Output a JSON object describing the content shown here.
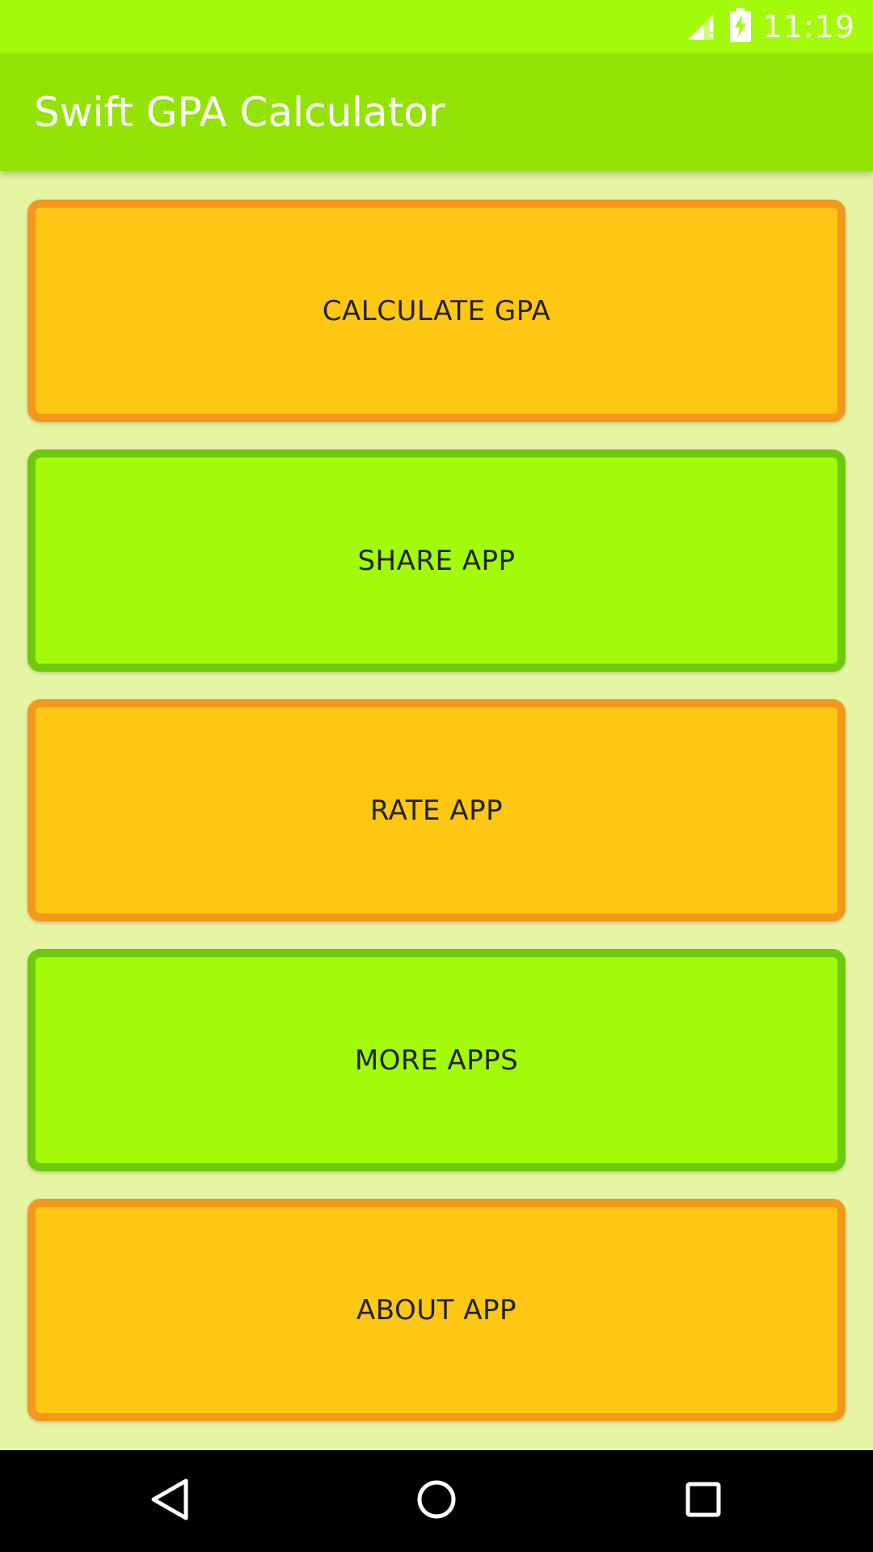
{
  "status_bar": {
    "time": "11:19",
    "icons": [
      "signal-icon",
      "battery-charging-icon"
    ]
  },
  "app_bar": {
    "title": "Swift GPA Calculator"
  },
  "menu": {
    "buttons": [
      {
        "label": "CALCULATE GPA",
        "style": "orange"
      },
      {
        "label": "SHARE APP",
        "style": "green"
      },
      {
        "label": "RATE APP",
        "style": "orange"
      },
      {
        "label": "MORE APPS",
        "style": "green"
      },
      {
        "label": "ABOUT APP",
        "style": "orange"
      }
    ]
  },
  "nav_bar": {
    "icons": [
      "back-icon",
      "home-icon",
      "recents-icon"
    ]
  },
  "colors": {
    "status_bar": "#a3fb0b",
    "app_bar": "#93e406",
    "background": "#e6f5a4",
    "orange_fill": "#fdc714",
    "orange_border": "#f3981d",
    "green_fill": "#a3fb0b",
    "green_border": "#6fc90e"
  }
}
